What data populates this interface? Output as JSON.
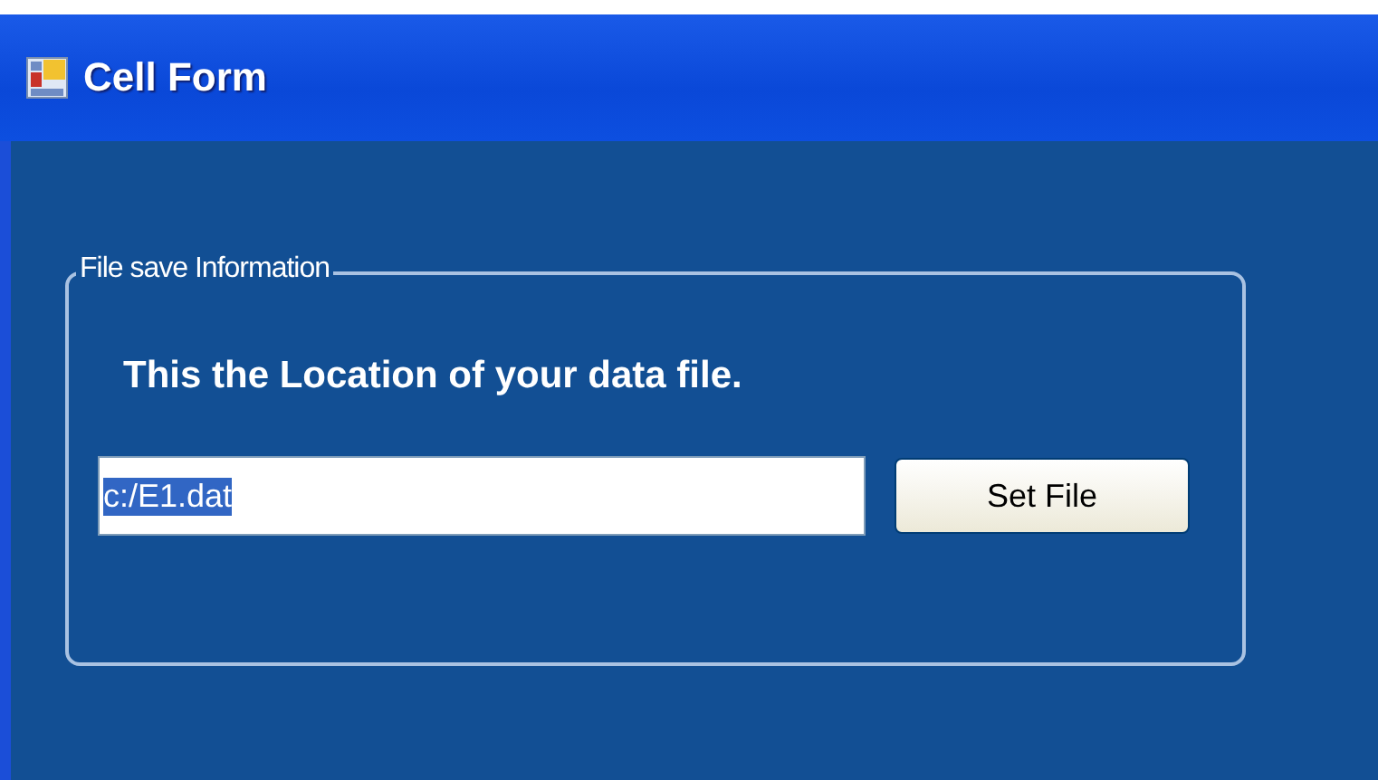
{
  "window": {
    "title": "Cell Form"
  },
  "group": {
    "legend": "File save Information",
    "message": "This the Location of your data file.",
    "file_field": {
      "value": "c:/E1.dat",
      "text_selected": true
    },
    "button": "Set File"
  }
}
